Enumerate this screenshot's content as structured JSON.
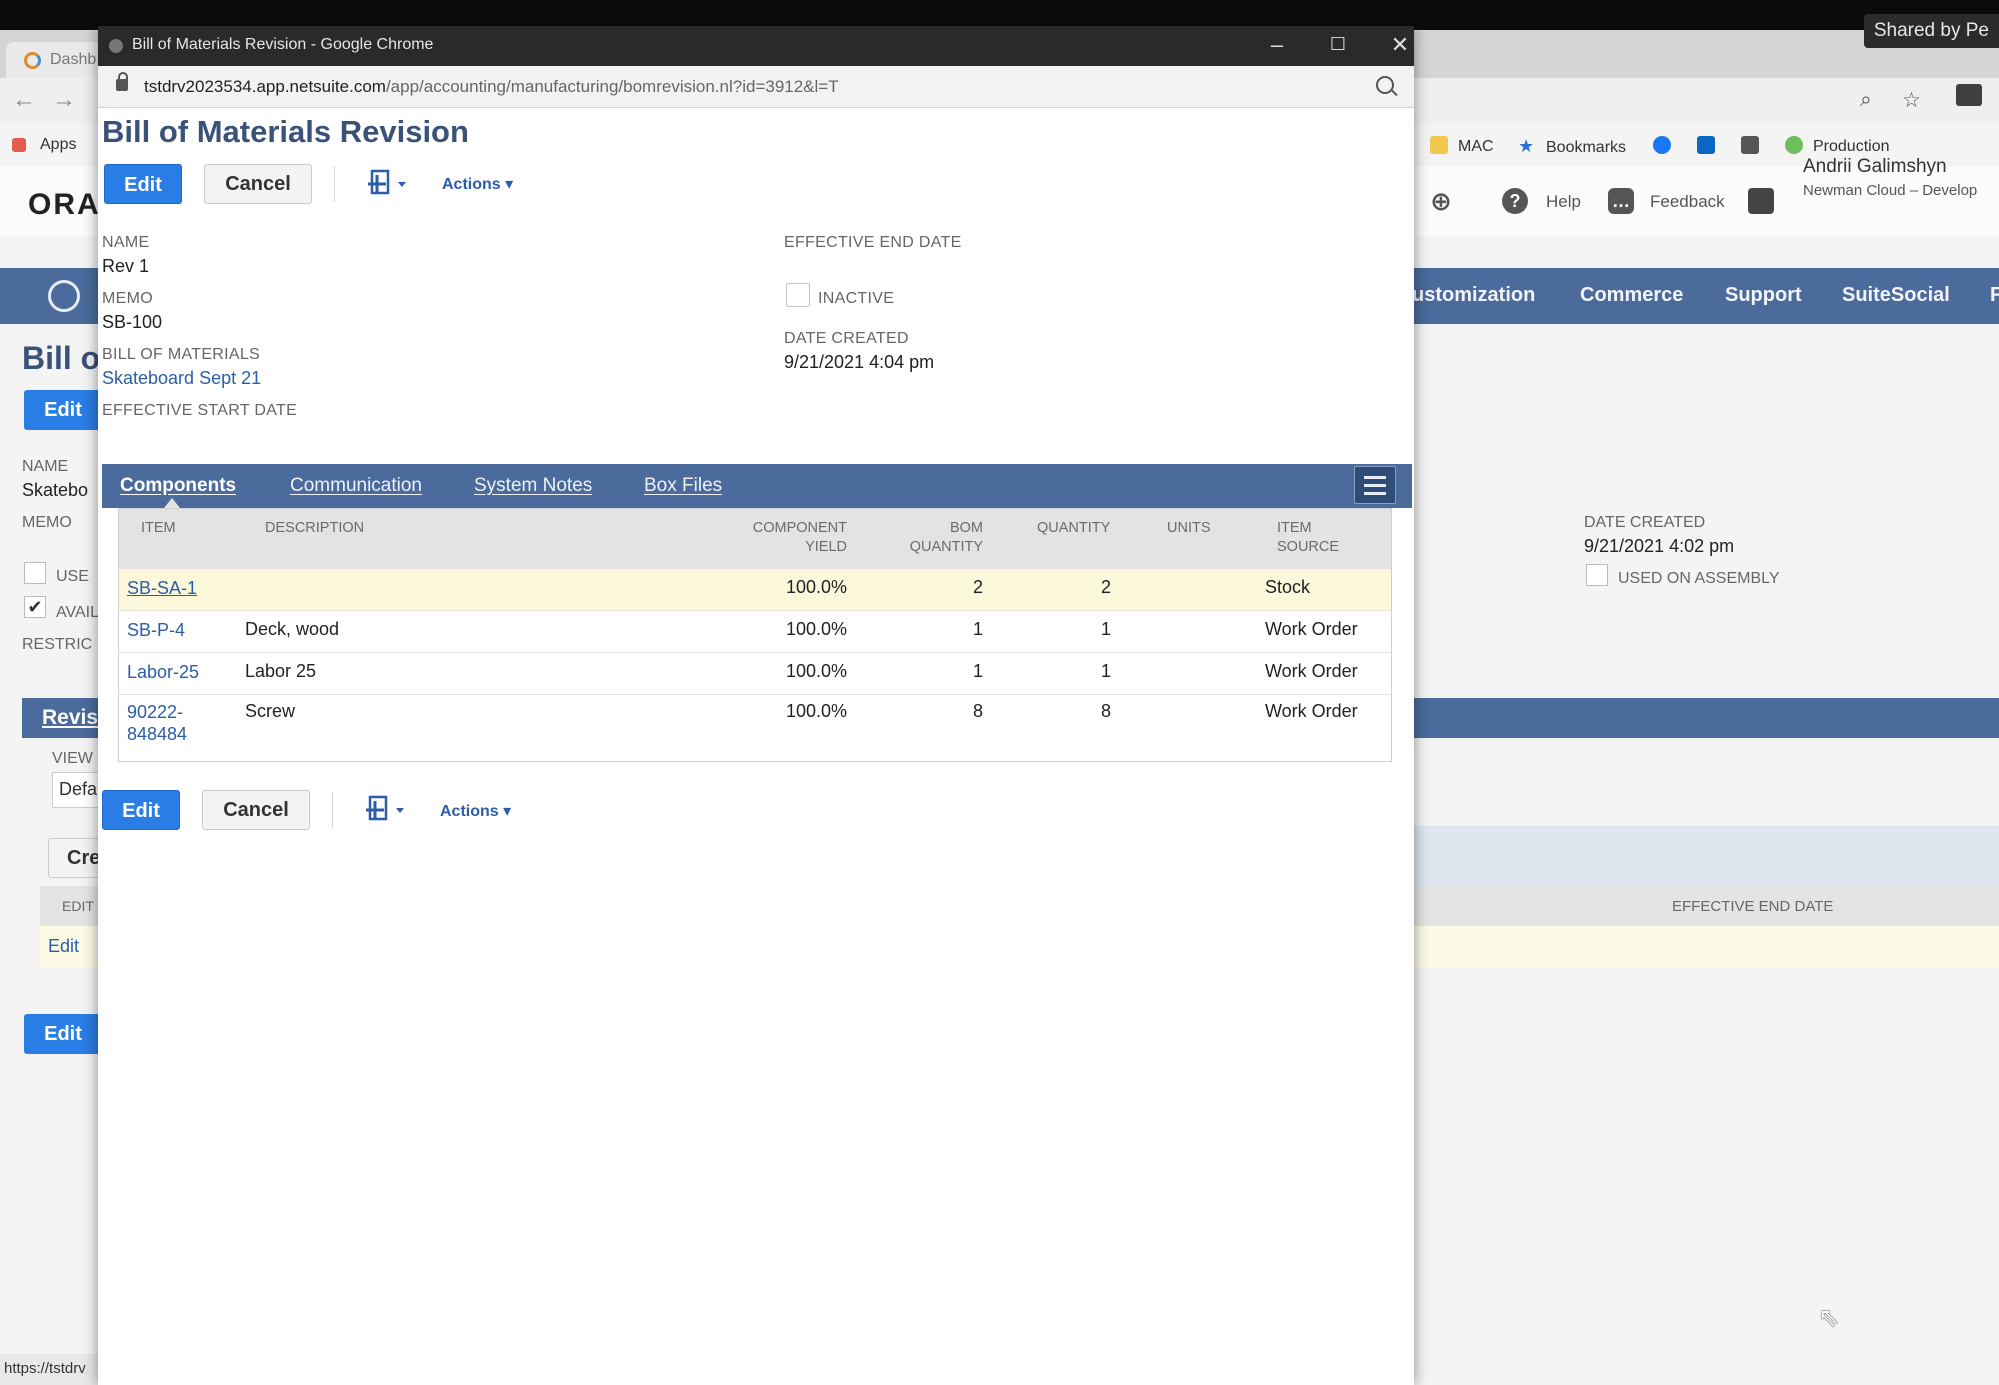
{
  "share": {
    "label": "Shared by Pe"
  },
  "background": {
    "tab_label": "Dashb",
    "bookmarks": {
      "apps": "Apps",
      "mac": "MAC",
      "bookmarks": "Bookmarks",
      "production": "Production"
    },
    "logo": "ORA",
    "header": {
      "help": "Help",
      "feedback": "Feedback"
    },
    "user": {
      "name": "Andrii Galimshyn",
      "subtitle": "Newman Cloud – Develop"
    },
    "menu": [
      "ustomization",
      "Commerce",
      "Support",
      "SuiteSocial",
      "F"
    ],
    "page_title": "Bill o",
    "edit_label": "Edit",
    "fields": {
      "name_label": "NAME",
      "name_value": "Skatebo",
      "memo_label": "MEMO",
      "use_label": "USE",
      "avail_label": "AVAIL",
      "restrict_label": "RESTRIC",
      "date_created_label": "DATE CREATED",
      "date_created_value": "9/21/2021 4:02 pm",
      "used_on_assembly_label": "USED ON ASSEMBLY"
    },
    "subtab": "Revis",
    "view_label": "VIEW",
    "view_value": "Defa",
    "create_label": "Cre",
    "list_header_edit": "EDIT",
    "list_header_end_date": "EFFECTIVE END DATE",
    "list_row_edit": "Edit",
    "bottom_edit_label": "Edit",
    "status_url": "https://tstdrv"
  },
  "popup": {
    "window_title": "Bill of Materials Revision - Google Chrome",
    "url_host": "tstdrv2023534.app.netsuite.com",
    "url_path": "/app/accounting/manufacturing/bomrevision.nl?id=3912&l=T",
    "page_title": "Bill of Materials Revision",
    "buttons": {
      "edit": "Edit",
      "cancel": "Cancel",
      "actions": "Actions ▾"
    },
    "fields": {
      "name_label": "NAME",
      "name_value": "Rev 1",
      "memo_label": "MEMO",
      "memo_value": "SB-100",
      "bom_label": "BILL OF MATERIALS",
      "bom_value": "Skateboard Sept 21",
      "start_date_label": "EFFECTIVE START DATE",
      "end_date_label": "EFFECTIVE END DATE",
      "inactive_label": "INACTIVE",
      "date_created_label": "DATE CREATED",
      "date_created_value": "9/21/2021 4:04 pm"
    },
    "tabs": [
      "Components",
      "Communication",
      "System Notes",
      "Box Files"
    ],
    "grid": {
      "headers": {
        "item": "ITEM",
        "description": "DESCRIPTION",
        "yield_1": "COMPONENT",
        "yield_2": "YIELD",
        "bom_qty_1": "BOM",
        "bom_qty_2": "QUANTITY",
        "quantity": "QUANTITY",
        "units": "UNITS",
        "source_1": "ITEM",
        "source_2": "SOURCE"
      },
      "rows": [
        {
          "item": "SB-SA-1",
          "item_2": "",
          "description": "",
          "yield": "100.0%",
          "bom_qty": "2",
          "quantity": "2",
          "units": "",
          "source": "Stock"
        },
        {
          "item": "SB-P-4",
          "item_2": "",
          "description": "Deck, wood",
          "yield": "100.0%",
          "bom_qty": "1",
          "quantity": "1",
          "units": "",
          "source": "Work Order"
        },
        {
          "item": "Labor-25",
          "item_2": "",
          "description": "Labor 25",
          "yield": "100.0%",
          "bom_qty": "1",
          "quantity": "1",
          "units": "",
          "source": "Work Order"
        },
        {
          "item": "90222-",
          "item_2": "848484",
          "description": "Screw",
          "yield": "100.0%",
          "bom_qty": "8",
          "quantity": "8",
          "units": "",
          "source": "Work Order"
        }
      ]
    }
  },
  "colors": {
    "accent_blue": "#2b7de6",
    "nav_blue": "#4a6b9c",
    "title_blue": "#3a5277",
    "link_blue": "#2a5ea8",
    "highlight_row": "#fbf8dc"
  }
}
